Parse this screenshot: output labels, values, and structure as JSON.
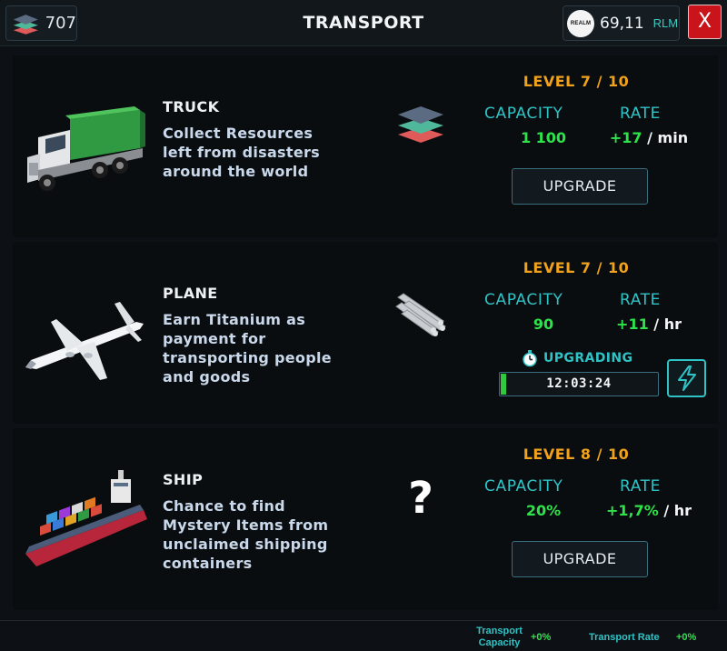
{
  "header": {
    "resource_count": "707",
    "title": "TRANSPORT",
    "currency_logo_text": "REALM",
    "currency_value": "69,11",
    "currency_unit": "RLM",
    "close_label": "X"
  },
  "transports": [
    {
      "name": "TRUCK",
      "description": "Collect Resources left from disasters around the world",
      "image": "truck-image",
      "resource_icon": "layers-icon",
      "level": "LEVEL 7 / 10",
      "capacity_label": "CAPACITY",
      "rate_label": "RATE",
      "capacity_value": "1 100",
      "rate_value": "+17",
      "rate_unit": " / min",
      "action": "UPGRADE"
    },
    {
      "name": "PLANE",
      "description": "Earn Titanium as payment for transporting people and goods",
      "image": "plane-image",
      "resource_icon": "titanium-rods-icon",
      "level": "LEVEL 7 / 10",
      "capacity_label": "CAPACITY",
      "rate_label": "RATE",
      "capacity_value": "90",
      "rate_value": "+11",
      "rate_unit": " / hr",
      "status_label": "UPGRADING",
      "timer": "12:03:24",
      "timer_progress": 0.03
    },
    {
      "name": "SHIP",
      "description": "Chance to find Mystery Items from unclaimed shipping containers",
      "image": "ship-image",
      "resource_icon": "question-mark-icon",
      "level": "LEVEL 8 / 10",
      "capacity_label": "CAPACITY",
      "rate_label": "RATE",
      "capacity_value": "20%",
      "rate_value": "+1,7%",
      "rate_unit": " / hr",
      "action": "UPGRADE"
    }
  ],
  "footer": {
    "capacity_label": "Transport Capacity",
    "capacity_value": "+0%",
    "rate_label": "Transport Rate",
    "rate_value": "+0%"
  },
  "colors": {
    "accent": "#2fc3c6",
    "level": "#f0a21d",
    "value": "#2ee24a",
    "close": "#c9141c"
  }
}
